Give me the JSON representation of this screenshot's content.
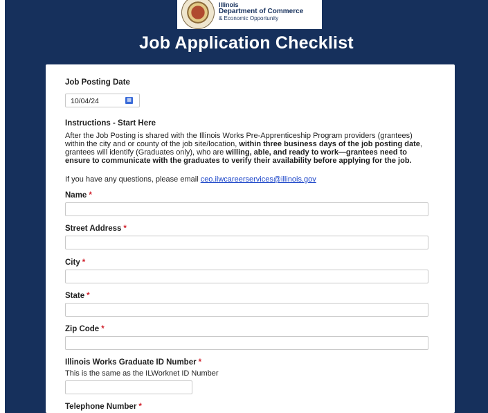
{
  "header": {
    "logo_line1": "Illinois",
    "logo_line2": "Department of Commerce",
    "logo_line3": "& Economic Opportunity",
    "title": "Job Application Checklist"
  },
  "form": {
    "job_posting_date_label": "Job Posting Date",
    "job_posting_date_value": "10/04/24",
    "instructions_heading": "Instructions - Start Here",
    "instructions_part1": "After the Job Posting is shared with the Illinois Works Pre-Apprenticeship Program providers (grantees) within the city and or county of the job site/location, ",
    "instructions_bold1": "within three business days of the job posting date",
    "instructions_part2": ", grantees will identify (Graduates only), who are ",
    "instructions_bold2": "willing, able, and ready to work—grantees need to ensure to communicate with the graduates to verify their availability before applying for the job.",
    "contact_text": "If you have any questions, please email ",
    "contact_email": "ceo.ilwcareerservices@illinois.gov",
    "required_marker": "*",
    "fields": {
      "name": {
        "label": "Name",
        "value": ""
      },
      "street_address": {
        "label": "Street Address",
        "value": ""
      },
      "city": {
        "label": "City",
        "value": ""
      },
      "state": {
        "label": "State",
        "value": ""
      },
      "zip_code": {
        "label": "Zip Code",
        "value": ""
      },
      "graduate_id": {
        "label": "Illinois Works Graduate ID Number",
        "hint": "This is the same as the ILWorknet ID Number",
        "value": ""
      },
      "telephone": {
        "label": "Telephone Number"
      }
    }
  },
  "colors": {
    "background": "#16305c",
    "required": "#d1242f",
    "link": "#1a44c8"
  }
}
